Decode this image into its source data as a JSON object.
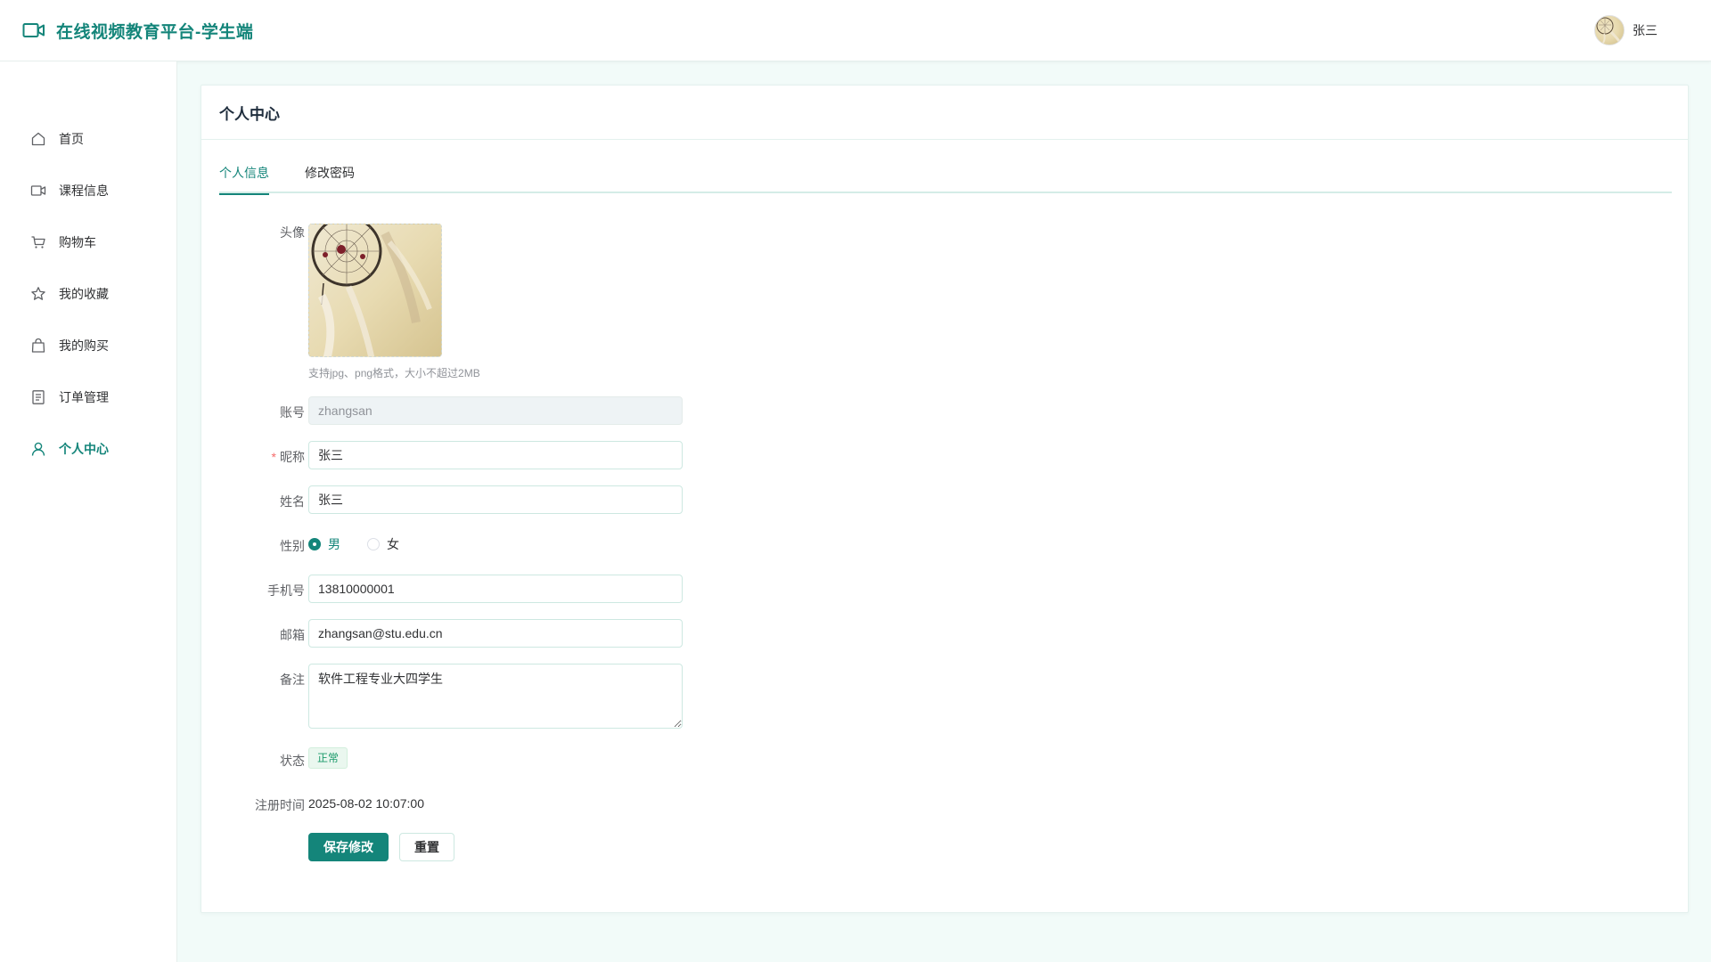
{
  "header": {
    "title": "在线视频教育平台-学生端",
    "brand_icon": "video-camera-icon",
    "user_name": "张三"
  },
  "sidebar": {
    "items": [
      {
        "label": "首页",
        "icon": "home-icon",
        "active": false
      },
      {
        "label": "课程信息",
        "icon": "video-icon",
        "active": false
      },
      {
        "label": "购物车",
        "icon": "cart-icon",
        "active": false
      },
      {
        "label": "我的收藏",
        "icon": "star-icon",
        "active": false
      },
      {
        "label": "我的购买",
        "icon": "bag-icon",
        "active": false
      },
      {
        "label": "订单管理",
        "icon": "document-icon",
        "active": false
      },
      {
        "label": "个人中心",
        "icon": "user-icon",
        "active": true
      }
    ]
  },
  "main": {
    "title": "个人中心",
    "tabs": [
      {
        "label": "个人信息",
        "active": true
      },
      {
        "label": "修改密码",
        "active": false
      }
    ],
    "form": {
      "avatar_label": "头像",
      "avatar_hint": "支持jpg、png格式，大小不超过2MB",
      "account_label": "账号",
      "account_value": "zhangsan",
      "nickname_required": "*",
      "nickname_label": "昵称",
      "nickname_value": "张三",
      "name_label": "姓名",
      "name_value": "张三",
      "gender_label": "性别",
      "gender_options": [
        "男",
        "女"
      ],
      "gender_selected": "男",
      "phone_label": "手机号",
      "phone_value": "13810000001",
      "email_label": "邮箱",
      "email_value": "zhangsan@stu.edu.cn",
      "remark_label": "备注",
      "remark_value": "软件工程专业大四学生",
      "status_label": "状态",
      "status_value": "正常",
      "register_label": "注册时间",
      "register_value": "2025-08-02 10:07:00",
      "save_button": "保存修改",
      "reset_button": "重置"
    }
  },
  "colors": {
    "accent": "#14857a",
    "page_bg": "#f2fbf9",
    "required": "#f56c6c",
    "status_green": "#1a9a6a"
  }
}
